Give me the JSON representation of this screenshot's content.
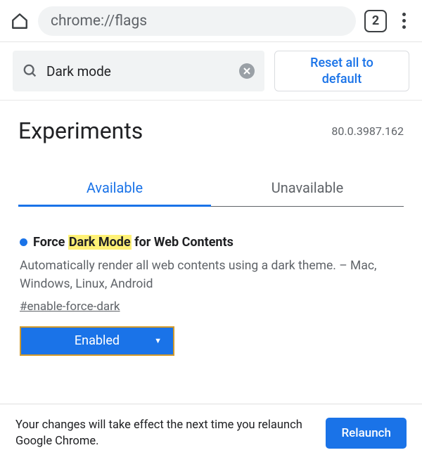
{
  "browser": {
    "url": "chrome://flags",
    "tab_count": "2"
  },
  "search": {
    "value": "Dark mode",
    "reset_label": "Reset all to default"
  },
  "header": {
    "title": "Experiments",
    "version": "80.0.3987.162"
  },
  "tabs": {
    "available": "Available",
    "unavailable": "Unavailable"
  },
  "flag": {
    "prefix": "Force ",
    "highlight": "Dark Mode",
    "suffix": " for Web Contents",
    "description": "Automatically render all web contents using a dark theme. – Mac, Windows, Linux, Android",
    "hash": "#enable-force-dark",
    "selected": "Enabled"
  },
  "relaunch": {
    "message": "Your changes will take effect the next time you relaunch Google Chrome.",
    "button": "Relaunch"
  }
}
